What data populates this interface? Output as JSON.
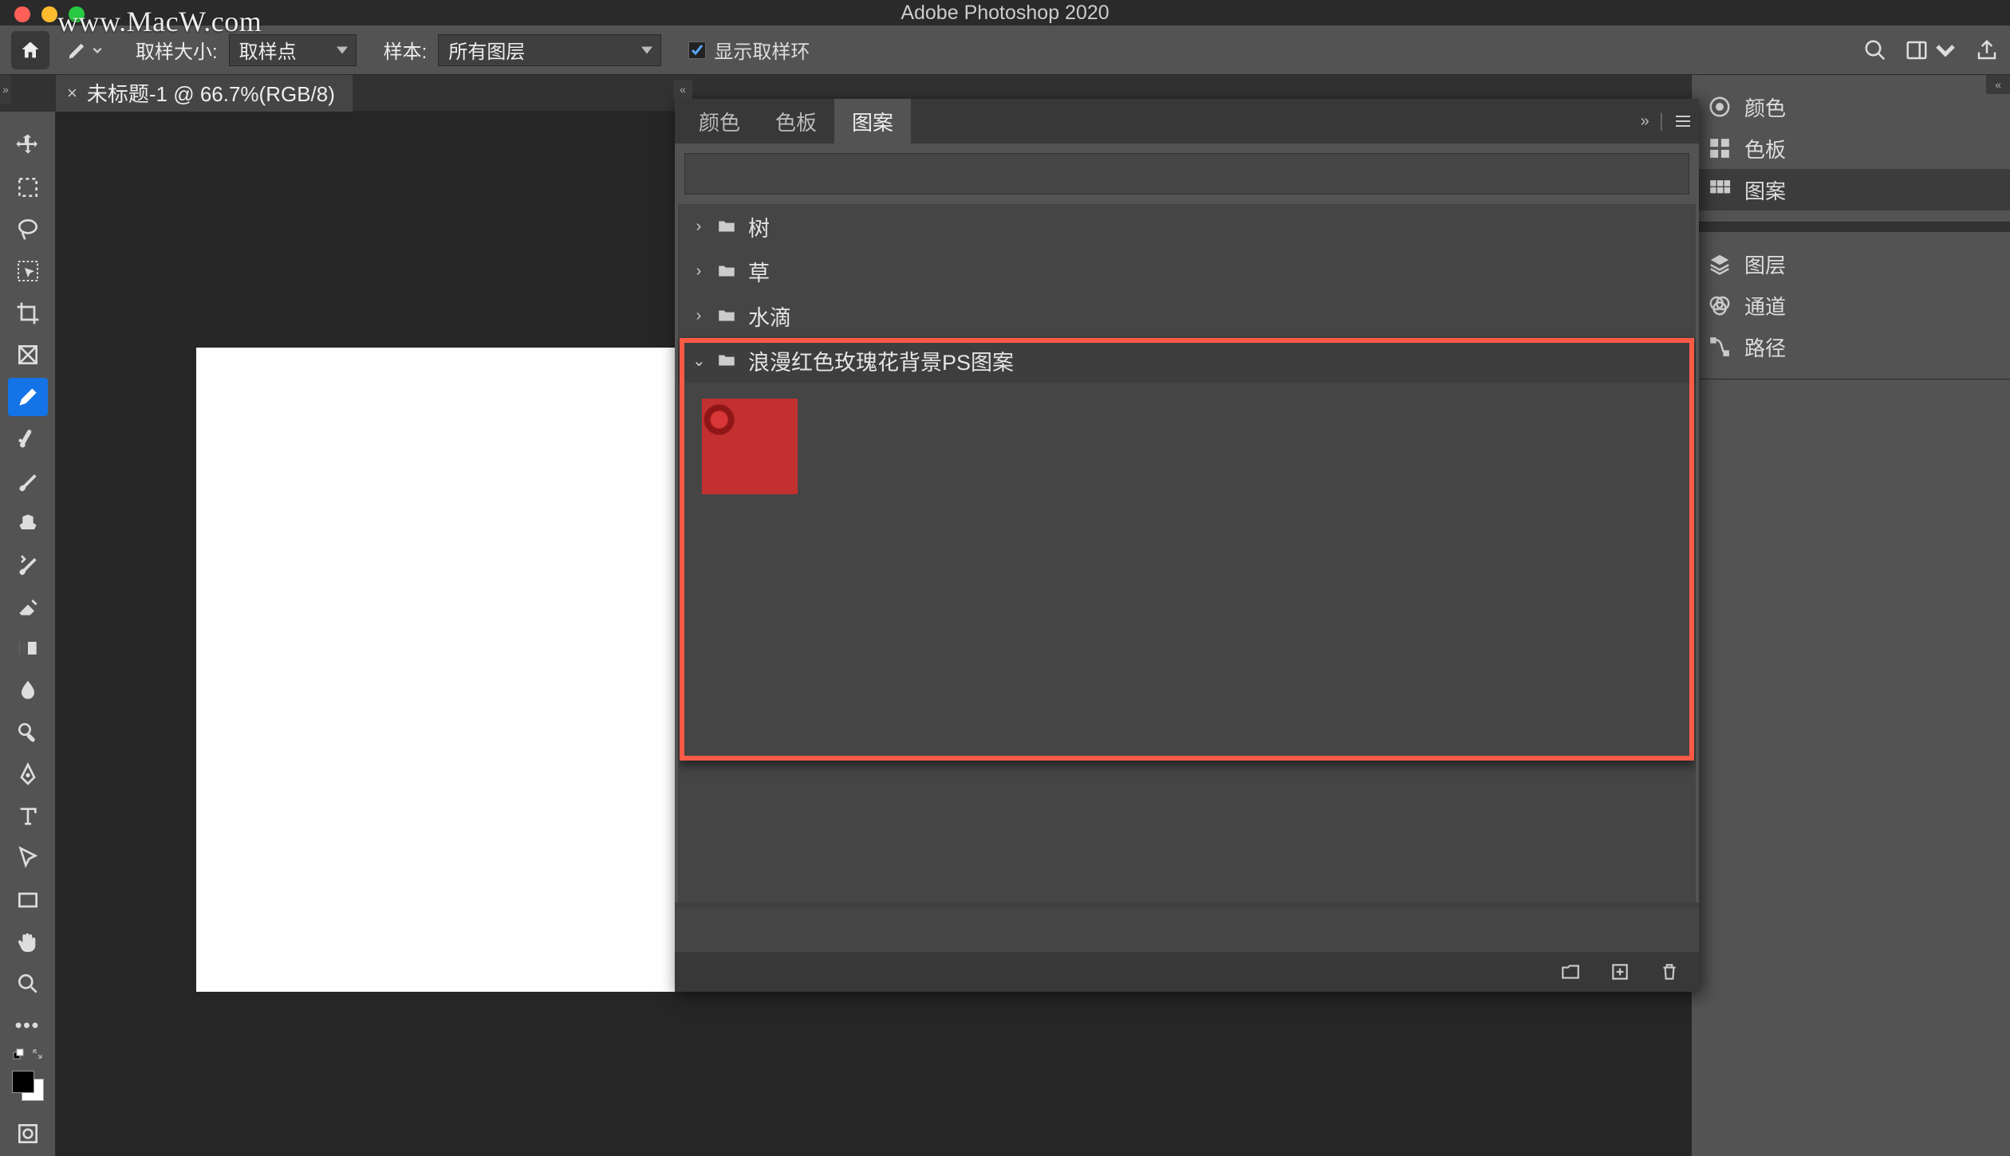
{
  "watermark": "www.MacW.com",
  "app_title": "Adobe Photoshop 2020",
  "options_bar": {
    "sample_size_label": "取样大小:",
    "sample_size_value": "取样点",
    "sample_label": "样本:",
    "sample_value": "所有图层",
    "show_ring_label": "显示取样环"
  },
  "document_tab": {
    "title": "未标题-1 @ 66.7%(RGB/8)"
  },
  "pattern_panel": {
    "tabs": {
      "color": "颜色",
      "swatch": "色板",
      "pattern": "图案"
    },
    "folders": {
      "tree": "树",
      "grass": "草",
      "water": "水滴",
      "rose": "浪漫红色玫瑰花背景PS图案"
    }
  },
  "right_panels": {
    "color": "颜色",
    "swatches": "色板",
    "patterns": "图案",
    "layers": "图层",
    "channels": "通道",
    "paths": "路径"
  },
  "glyphs": {
    "chevron_left": "«",
    "chevron_right_dbl": "»",
    "chev_right": "›",
    "chev_down": "⌄"
  }
}
